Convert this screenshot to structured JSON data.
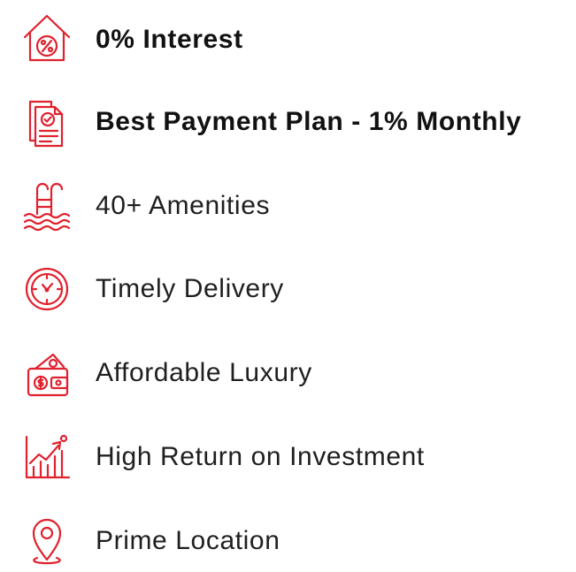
{
  "accent_color": "#e0212e",
  "features": [
    {
      "label": "0% Interest",
      "icon": "percent-house-icon",
      "bold": true
    },
    {
      "label": "Best Payment Plan - 1% Monthly",
      "icon": "payment-document-icon",
      "bold": true
    },
    {
      "label": "40+ Amenities",
      "icon": "swimming-pool-icon",
      "bold": false
    },
    {
      "label": "Timely Delivery",
      "icon": "clock-icon",
      "bold": false
    },
    {
      "label": "Affordable Luxury",
      "icon": "wallet-money-icon",
      "bold": false
    },
    {
      "label": "High Return on Investment",
      "icon": "growth-chart-icon",
      "bold": false
    },
    {
      "label": "Prime Location",
      "icon": "location-pin-icon",
      "bold": false
    }
  ]
}
